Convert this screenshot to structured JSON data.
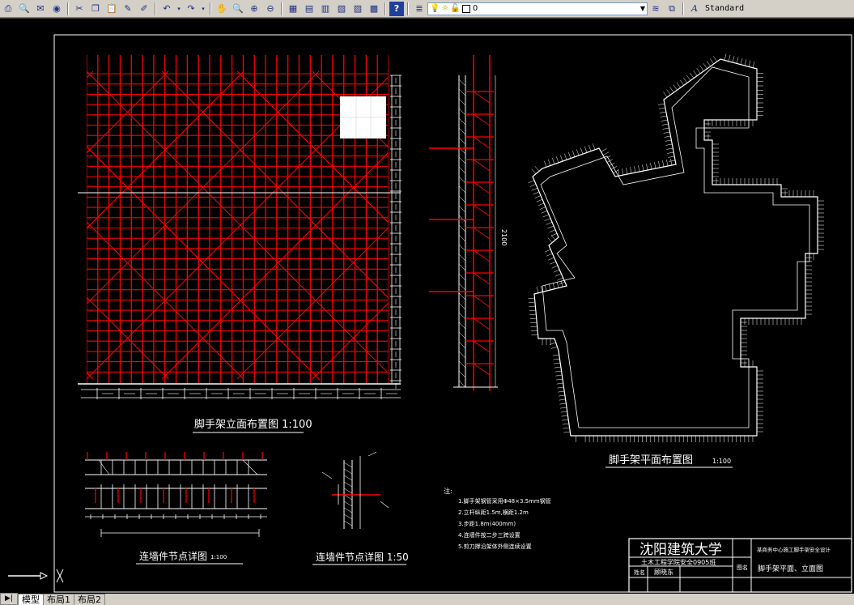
{
  "toolbar": {
    "layer_value": "0",
    "text_style": "Standard"
  },
  "drawing": {
    "elevation_title": "脚手架立面布置图 1:100",
    "plan_title": "脚手架平面布置图",
    "plan_scale": "1:100",
    "wall_detail_title": "连墙件节点详图",
    "wall_detail_scale": "1:100",
    "wall_node_title": "连墙件节点详图 1:50",
    "side_dim": "2100",
    "notes_heading": "注:",
    "notes": [
      "1.脚手架钢管采用Φ48×3.5mm钢管",
      "2.立杆纵距1.5m,横距1.2m",
      "3.步距1.8m(400mm)",
      "4.连墙件按二步三跨设置",
      "5.剪刀撑沿架体外侧连续设置"
    ],
    "title_block": {
      "school": "沈阳建筑大学",
      "dept": "土木工程学院安全0905班",
      "name_label": "姓名",
      "name_value": "顾晓东",
      "right_top": "某商务中心施工脚手架安全设计",
      "drawing_label": "图名",
      "drawing_name": "脚手架平面、立面图"
    }
  },
  "tabs": [
    "模型",
    "布局1",
    "布局2"
  ],
  "colors": {
    "scaffold": "#ff0000",
    "lines": "#ffffff",
    "background": "#000000"
  }
}
